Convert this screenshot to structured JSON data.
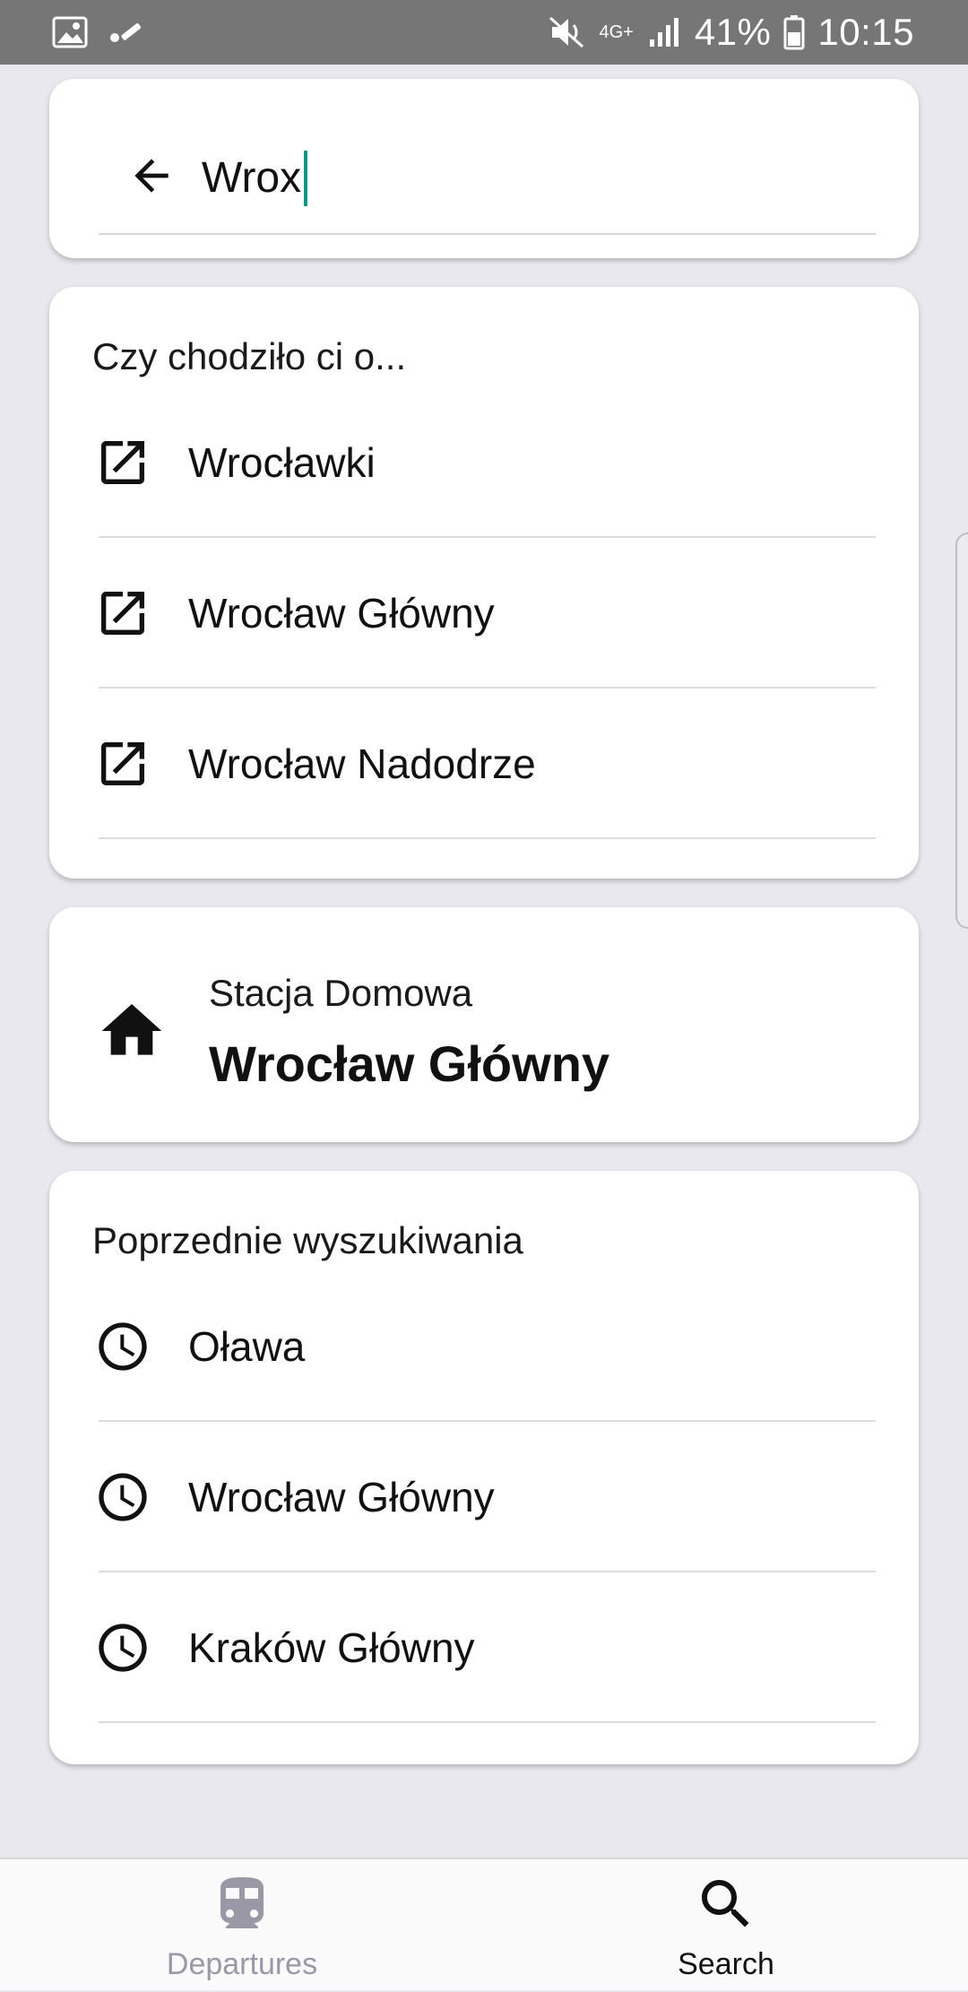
{
  "status_bar": {
    "battery_percent": "41%",
    "time": "10:15",
    "network": "4G+"
  },
  "search": {
    "query": "Wrox"
  },
  "suggestions": {
    "title": "Czy chodziło ci o...",
    "items": [
      {
        "label": "Wrocławki",
        "icon": "open-external-icon"
      },
      {
        "label": "Wrocław Główny",
        "icon": "open-external-icon"
      },
      {
        "label": "Wrocław Nadodrze",
        "icon": "open-external-icon"
      }
    ]
  },
  "home_station": {
    "label": "Stacja Domowa",
    "station": "Wrocław Główny",
    "icon": "home-icon"
  },
  "recent": {
    "title": "Poprzednie wyszukiwania",
    "items": [
      {
        "label": "Oława",
        "icon": "clock-icon"
      },
      {
        "label": "Wrocław Główny",
        "icon": "clock-icon"
      },
      {
        "label": "Kraków Główny",
        "icon": "clock-icon"
      }
    ]
  },
  "bottom_nav": {
    "departures_label": "Departures",
    "search_label": "Search",
    "active": "Search"
  },
  "colors": {
    "accent": "#0f9488",
    "background": "#e8e8ee",
    "inactive_nav": "#9a97a7",
    "status_bar": "#767676"
  }
}
